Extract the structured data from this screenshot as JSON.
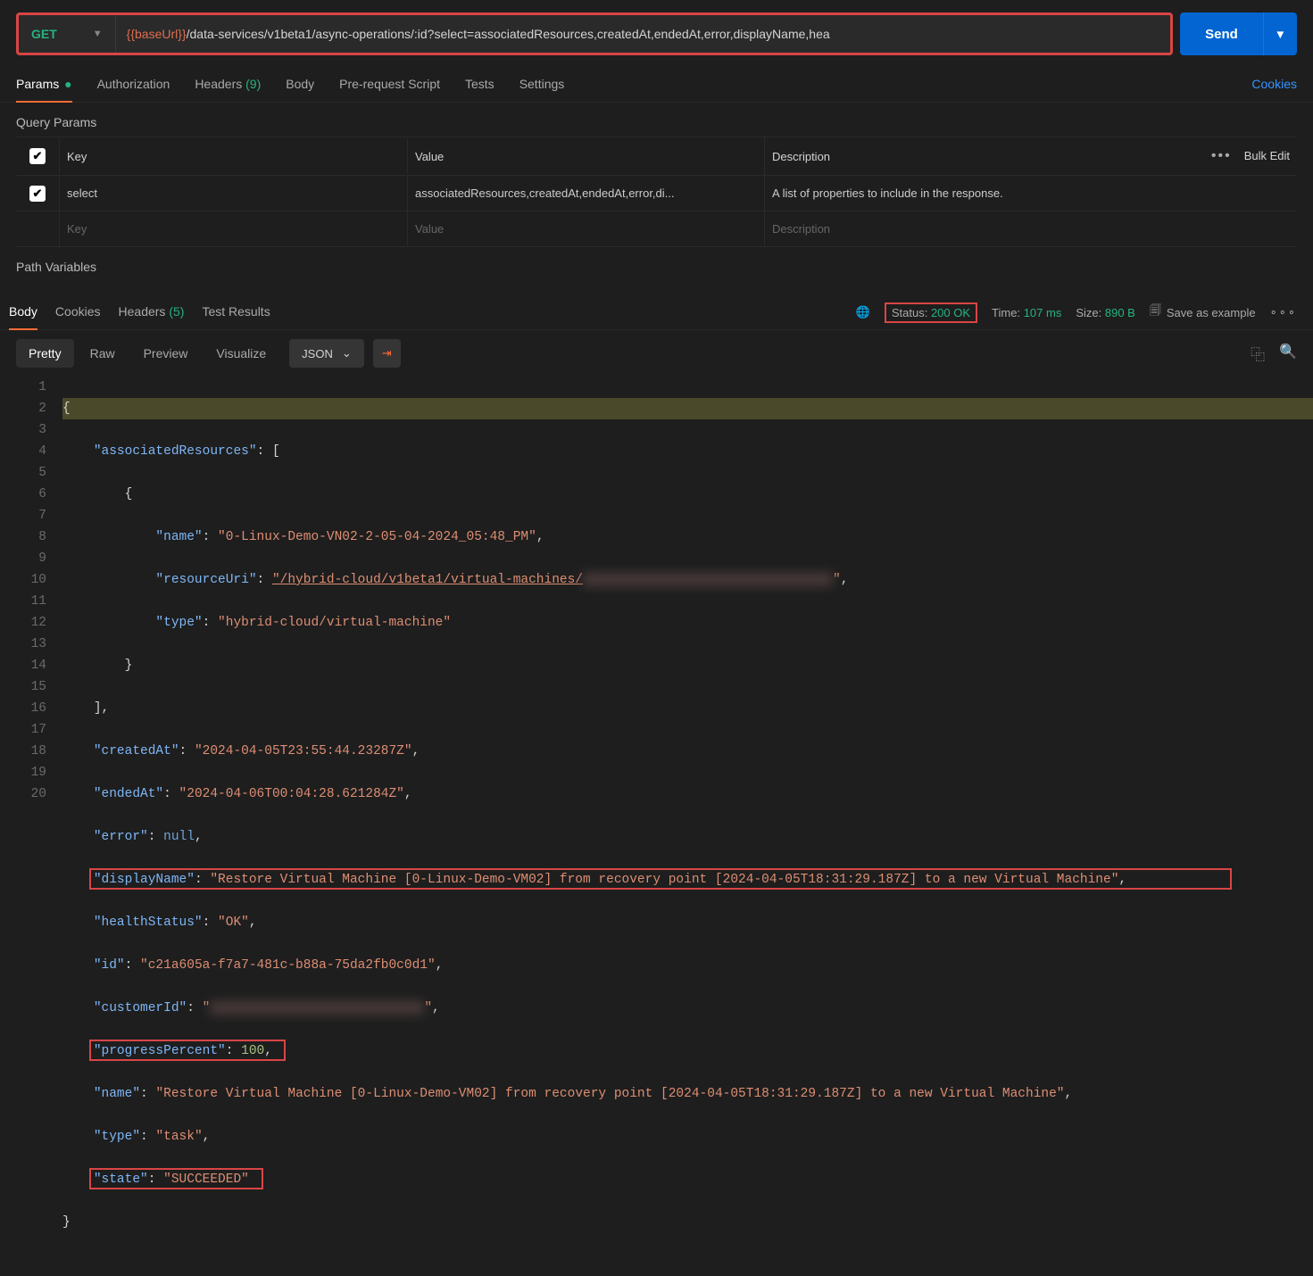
{
  "request": {
    "method": "GET",
    "url_var": "{{baseUrl}}",
    "url_path": "/data-services/v1beta1/async-operations/:id?select=associatedResources,createdAt,endedAt,error,displayName,hea",
    "send": "Send"
  },
  "tabs": {
    "params": "Params",
    "authorization": "Authorization",
    "headers": "Headers",
    "headers_count": "(9)",
    "body": "Body",
    "prerequest": "Pre-request Script",
    "tests": "Tests",
    "settings": "Settings",
    "cookies": "Cookies"
  },
  "query": {
    "title": "Query Params",
    "header_key": "Key",
    "header_value": "Value",
    "header_desc": "Description",
    "bulk_edit": "Bulk Edit",
    "row_key": "select",
    "row_value": "associatedResources,createdAt,endedAt,error,di...",
    "row_desc": "A list of properties to include in the response.",
    "ph_key": "Key",
    "ph_value": "Value",
    "ph_desc": "Description"
  },
  "pathvars": {
    "title": "Path Variables"
  },
  "resp_tabs": {
    "body": "Body",
    "cookies": "Cookies",
    "headers": "Headers",
    "headers_count": "(5)",
    "test_results": "Test Results"
  },
  "resp_meta": {
    "status_label": "Status:",
    "status_value": "200 OK",
    "time_label": "Time:",
    "time_value": "107 ms",
    "size_label": "Size:",
    "size_value": "890 B",
    "save_example": "Save as example"
  },
  "view": {
    "pretty": "Pretty",
    "raw": "Raw",
    "preview": "Preview",
    "visualize": "Visualize",
    "format": "JSON"
  },
  "code": {
    "l1": "{",
    "l2_k": "\"associatedResources\"",
    "l2_r": ": [",
    "l3": "{",
    "l4_k": "\"name\"",
    "l4_v": "\"0-Linux-Demo-VN02-2-05-04-2024_05:48_PM\"",
    "l5_k": "\"resourceUri\"",
    "l5_v": "\"/hybrid-cloud/v1beta1/virtual-machines/",
    "l5_end": "\"",
    "l6_k": "\"type\"",
    "l6_v": "\"hybrid-cloud/virtual-machine\"",
    "l7": "}",
    "l8": "],",
    "l9_k": "\"createdAt\"",
    "l9_v": "\"2024-04-05T23:55:44.23287Z\"",
    "l10_k": "\"endedAt\"",
    "l10_v": "\"2024-04-06T00:04:28.621284Z\"",
    "l11_k": "\"error\"",
    "l11_v": "null",
    "l12_k": "\"displayName\"",
    "l12_v": "\"Restore Virtual Machine [0-Linux-Demo-VM02] from recovery point [2024-04-05T18:31:29.187Z] to a new Virtual Machine\"",
    "l13_k": "\"healthStatus\"",
    "l13_v": "\"OK\"",
    "l14_k": "\"id\"",
    "l14_v": "\"c21a605a-f7a7-481c-b88a-75da2fb0c0d1\"",
    "l15_k": "\"customerId\"",
    "l15_v": "\"",
    "l15_end": "\"",
    "l16_k": "\"progressPercent\"",
    "l16_v": "100",
    "l17_k": "\"name\"",
    "l17_v": "\"Restore Virtual Machine [0-Linux-Demo-VM02] from recovery point [2024-04-05T18:31:29.187Z] to a new Virtual Machine\"",
    "l18_k": "\"type\"",
    "l18_v": "\"task\"",
    "l19_k": "\"state\"",
    "l19_v": "\"SUCCEEDED\"",
    "l20": "}"
  }
}
